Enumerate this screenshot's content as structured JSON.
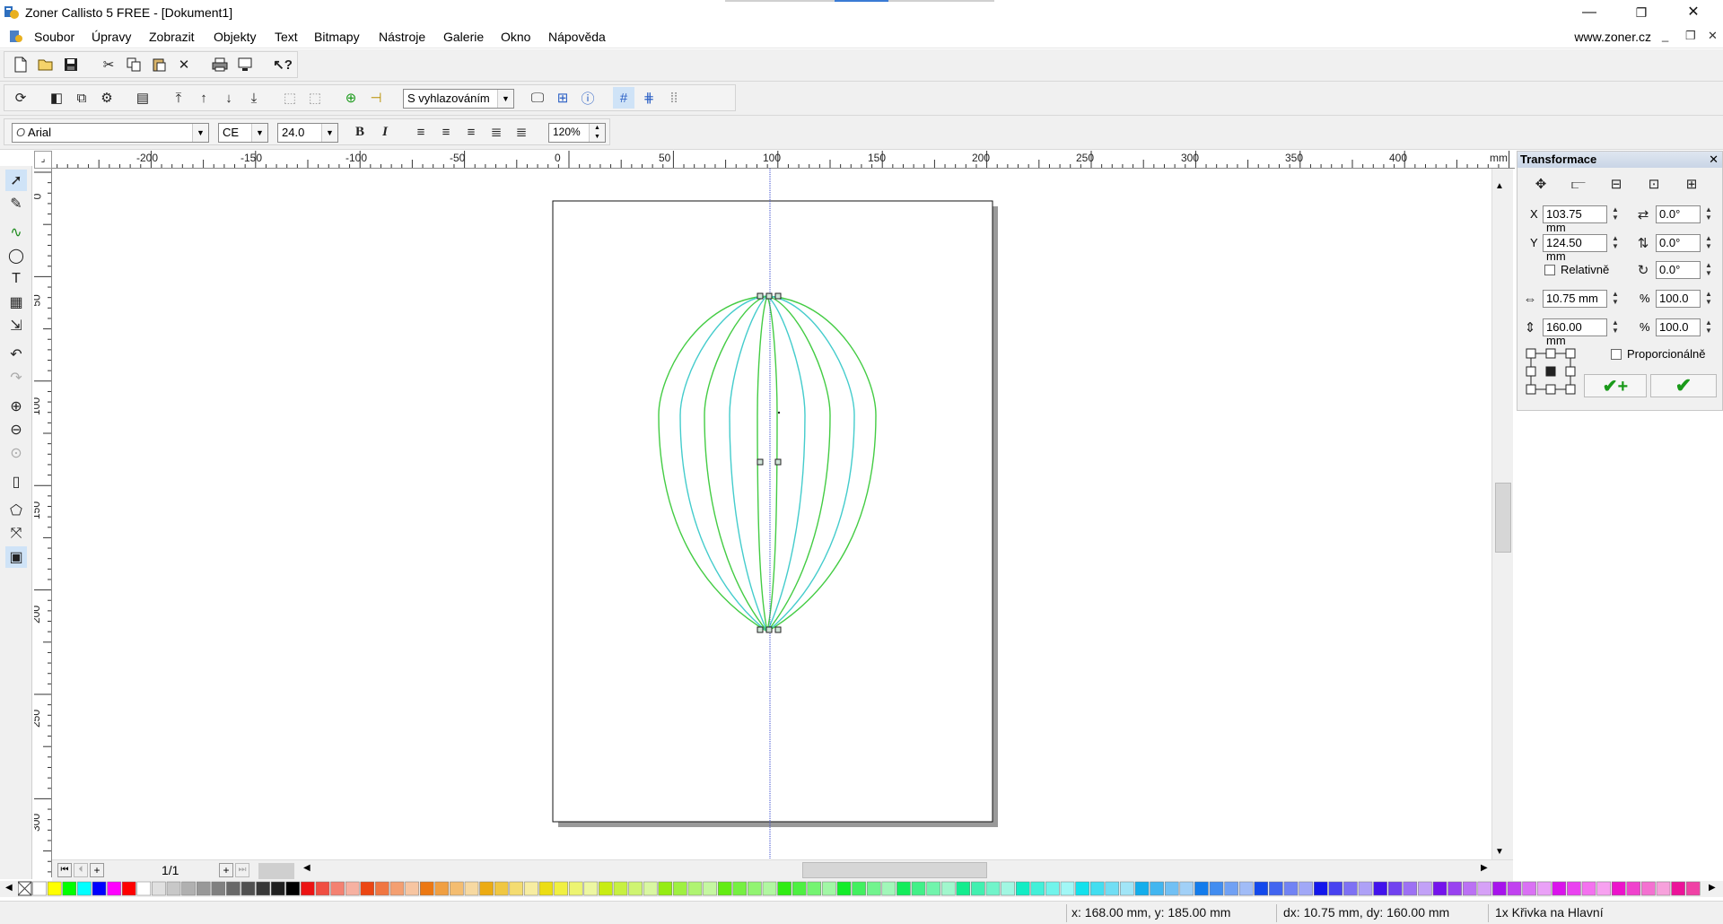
{
  "window": {
    "title": "Zoner Callisto 5 FREE - [Dokument1]",
    "controls": {
      "minimize": "—",
      "maximize": "❐",
      "close": "✕"
    }
  },
  "menubar": {
    "items": [
      "Soubor",
      "Úpravy",
      "Zobrazit",
      "Objekty",
      "Text",
      "Bitmapy",
      "Nástroje",
      "Galerie",
      "Okno",
      "Nápověda"
    ],
    "website": "www.zoner.cz"
  },
  "toolbar2": {
    "smoothing_select": "S vyhlazováním"
  },
  "text_toolbar": {
    "font_family": "Arial",
    "charset": "CE",
    "font_size": "24.0",
    "bold": "B",
    "italic": "I",
    "line_spacing": "120%"
  },
  "ruler": {
    "unit": "mm",
    "top_labels": [
      "-200",
      "-150",
      "-100",
      "-50",
      "0",
      "50",
      "100",
      "150",
      "200",
      "250",
      "300",
      "350",
      "400"
    ],
    "left_labels": [
      "0",
      "50",
      "100",
      "150",
      "200",
      "250",
      "300"
    ]
  },
  "transform_panel": {
    "title": "Transformace",
    "x_label": "X",
    "x_value": "103.75 mm",
    "y_label": "Y",
    "y_value": "124.50 mm",
    "relative_label": "Relativně",
    "rot1": "0.0°",
    "rot2": "0.0°",
    "rot3": "0.0°",
    "width_value": "10.75 mm",
    "height_value": "160.00 mm",
    "scale_w": "100.0",
    "scale_h": "100.0",
    "percent": "%",
    "proportional_label": "Proporcionálně"
  },
  "page_nav": {
    "page_indicator": "1/1"
  },
  "statusbar": {
    "cursor": "x: 168.00 mm, y: 185.00 mm",
    "delta": "dx: 10.75 mm, dy: 160.00 mm",
    "selection": "1x Křivka na Hlavní"
  },
  "colors": {
    "outer_curve": "#44cc44",
    "inner_curve": "#44cccc",
    "guide": "#3344cc"
  }
}
